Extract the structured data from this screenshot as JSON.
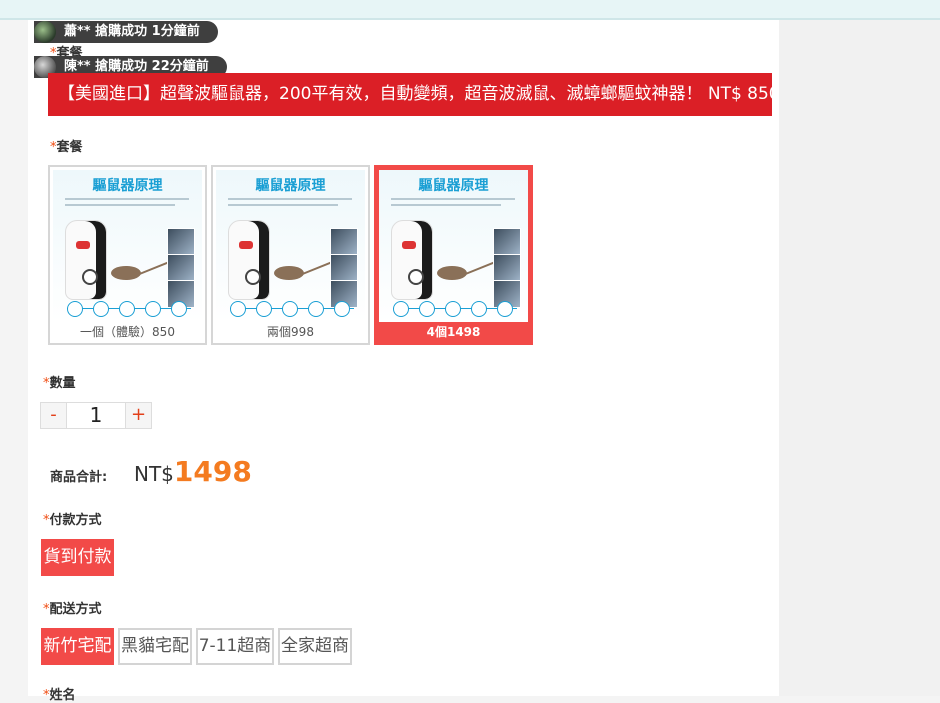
{
  "notifications": [
    {
      "text": "蕭** 搶購成功 1分鐘前"
    },
    {
      "text": "陳** 搶購成功 22分鐘前"
    }
  ],
  "banner": {
    "text": "【美國進口】超聲波驅鼠器，200平有效，自動變頻，超音波滅鼠、滅蟑螂驅蚊神器！ NT$ 850"
  },
  "package": {
    "required_mark": "*",
    "label": "套餐",
    "ghost_label": "套餐",
    "image_title": "驅鼠器原理",
    "options": [
      {
        "caption": "一個（體驗）850",
        "selected": false
      },
      {
        "caption": "兩個998",
        "selected": false
      },
      {
        "caption": "4個1498",
        "selected": true
      }
    ]
  },
  "quantity": {
    "label": "數量",
    "minus": "-",
    "plus": "+",
    "value": "1"
  },
  "total": {
    "label": "商品合計:",
    "currency": "NT$",
    "amount": "1498"
  },
  "payment": {
    "label": "付款方式",
    "options": [
      {
        "label": "貨到付款",
        "selected": true
      }
    ]
  },
  "shipping": {
    "label": "配送方式",
    "options": [
      {
        "label": "新竹宅配",
        "selected": true
      },
      {
        "label": "黑貓宅配",
        "selected": false
      },
      {
        "label": "7-11超商",
        "selected": false
      },
      {
        "label": "全家超商",
        "selected": false
      }
    ]
  },
  "name": {
    "label": "姓名"
  },
  "colors": {
    "accent": "#f24a48",
    "banner": "#db1f26",
    "price": "#f47b20",
    "required": "#f04b10"
  }
}
